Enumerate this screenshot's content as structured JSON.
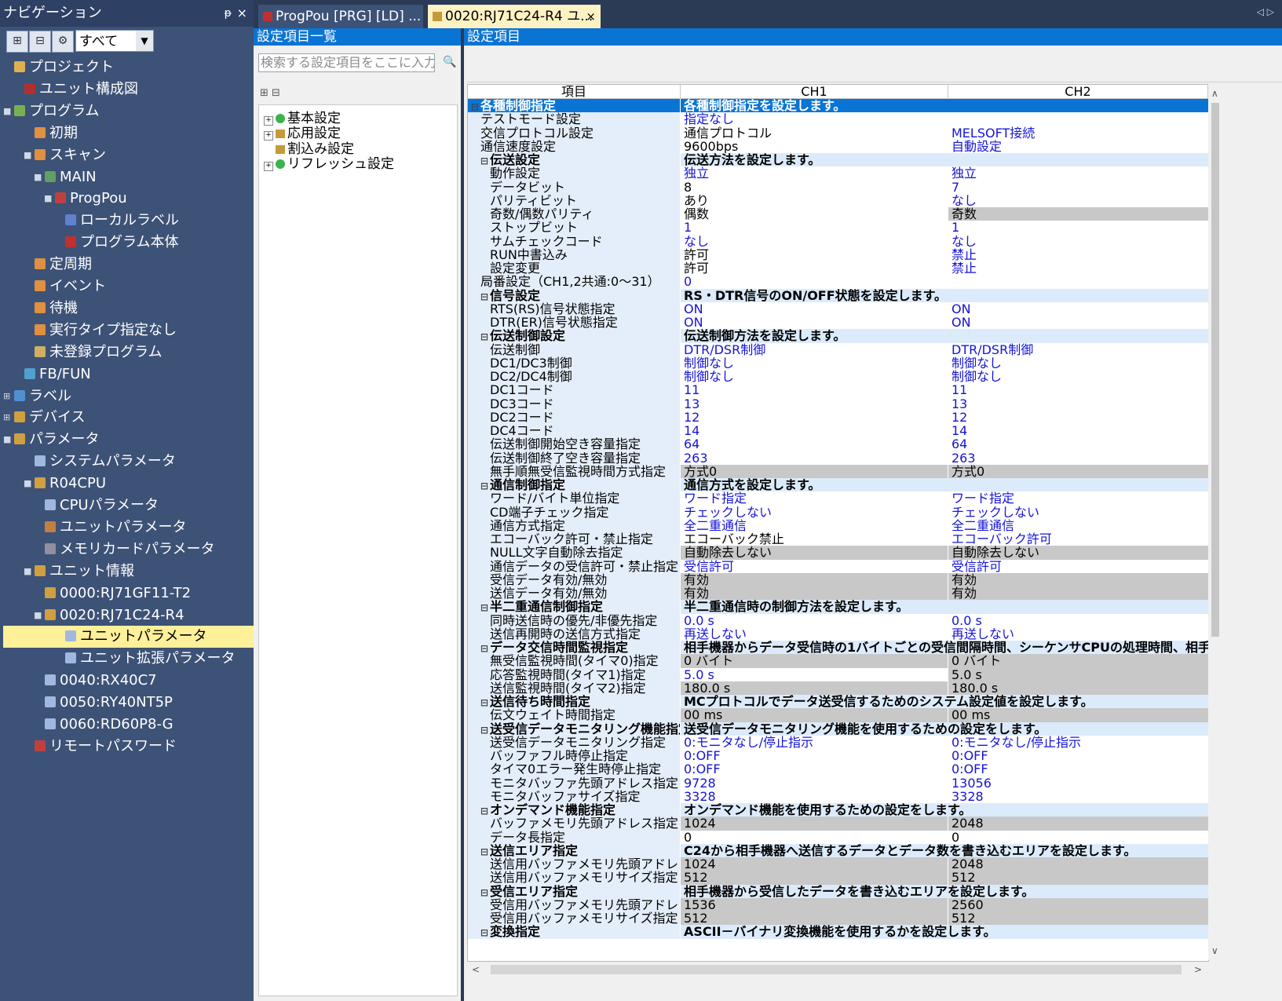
{
  "nav": {
    "title": "ナビゲーション",
    "pin": "ᵽ",
    "close": "×",
    "filter": "すべて",
    "items": [
      {
        "label": "プロジェクト",
        "indent": 0,
        "icon": "project-icon",
        "color": "#e0b050",
        "exp": ""
      },
      {
        "label": "ユニット構成図",
        "indent": 1,
        "icon": "unit-config-icon",
        "color": "#b03030",
        "exp": ""
      },
      {
        "label": "プログラム",
        "indent": 0,
        "icon": "program-folder-icon",
        "color": "#78b050",
        "exp": "■"
      },
      {
        "label": "初期",
        "indent": 2,
        "icon": "program-type-icon",
        "color": "#e09040",
        "exp": ""
      },
      {
        "label": "スキャン",
        "indent": 2,
        "icon": "program-type-icon",
        "color": "#e09040",
        "exp": "■"
      },
      {
        "label": "MAIN",
        "indent": 3,
        "icon": "task-icon",
        "color": "#60a060",
        "exp": "■"
      },
      {
        "label": "ProgPou",
        "indent": 4,
        "icon": "pou-icon",
        "color": "#c04040",
        "exp": "■"
      },
      {
        "label": "ローカルラベル",
        "indent": 5,
        "icon": "local-label-icon",
        "color": "#6080d0",
        "exp": ""
      },
      {
        "label": "プログラム本体",
        "indent": 5,
        "icon": "program-body-icon",
        "color": "#c03030",
        "exp": ""
      },
      {
        "label": "定周期",
        "indent": 2,
        "icon": "program-type-icon",
        "color": "#e09040",
        "exp": ""
      },
      {
        "label": "イベント",
        "indent": 2,
        "icon": "program-type-icon",
        "color": "#e09040",
        "exp": ""
      },
      {
        "label": "待機",
        "indent": 2,
        "icon": "program-type-icon",
        "color": "#e09040",
        "exp": ""
      },
      {
        "label": "実行タイプ指定なし",
        "indent": 2,
        "icon": "program-type-icon",
        "color": "#e09040",
        "exp": ""
      },
      {
        "label": "未登録プログラム",
        "indent": 2,
        "icon": "unregistered-icon",
        "color": "#d0b060",
        "exp": ""
      },
      {
        "label": "FB/FUN",
        "indent": 1,
        "icon": "fb-icon",
        "color": "#50a0d0",
        "exp": ""
      },
      {
        "label": "ラベル",
        "indent": 0,
        "icon": "label-icon",
        "color": "#5090d0",
        "exp": "⊞"
      },
      {
        "label": "デバイス",
        "indent": 0,
        "icon": "device-icon",
        "color": "#d0a040",
        "exp": "⊞"
      },
      {
        "label": "パラメータ",
        "indent": 0,
        "icon": "parameter-icon",
        "color": "#d0a040",
        "exp": "■"
      },
      {
        "label": "システムパラメータ",
        "indent": 2,
        "icon": "system-param-icon",
        "color": "#a0b8e0",
        "exp": ""
      },
      {
        "label": "R04CPU",
        "indent": 2,
        "icon": "cpu-icon",
        "color": "#d0a040",
        "exp": "■"
      },
      {
        "label": "CPUパラメータ",
        "indent": 3,
        "icon": "cpu-param-icon",
        "color": "#a0b8e0",
        "exp": ""
      },
      {
        "label": "ユニットパラメータ",
        "indent": 3,
        "icon": "unit-param-icon",
        "color": "#c08040",
        "exp": ""
      },
      {
        "label": "メモリカードパラメータ",
        "indent": 3,
        "icon": "memory-card-icon",
        "color": "#9090a0",
        "exp": ""
      },
      {
        "label": "ユニット情報",
        "indent": 2,
        "icon": "unit-info-icon",
        "color": "#d0a040",
        "exp": "■"
      },
      {
        "label": "0000:RJ71GF11-T2",
        "indent": 3,
        "icon": "module-icon",
        "color": "#d0a040",
        "exp": ""
      },
      {
        "label": "0020:RJ71C24-R4",
        "indent": 3,
        "icon": "module-icon",
        "color": "#d0a040",
        "exp": "■"
      },
      {
        "label": "ユニットパラメータ",
        "indent": 5,
        "icon": "module-param-icon",
        "color": "#a0b8e0",
        "exp": "",
        "selected": true
      },
      {
        "label": "ユニット拡張パラメータ",
        "indent": 5,
        "icon": "module-ext-param-icon",
        "color": "#a0b8e0",
        "exp": ""
      },
      {
        "label": "0040:RX40C7",
        "indent": 3,
        "icon": "module-icon",
        "color": "#a0b8e0",
        "exp": ""
      },
      {
        "label": "0050:RY40NT5P",
        "indent": 3,
        "icon": "module-icon",
        "color": "#a0b8e0",
        "exp": ""
      },
      {
        "label": "0060:RD60P8-G",
        "indent": 3,
        "icon": "module-icon",
        "color": "#a0b8e0",
        "exp": ""
      },
      {
        "label": "リモートパスワード",
        "indent": 2,
        "icon": "remote-password-icon",
        "color": "#c04040",
        "exp": ""
      }
    ]
  },
  "tabs": [
    {
      "label": "ProgPou [PRG] [LD] ...",
      "icon": "pou-icon"
    },
    {
      "label": "0020:RJ71C24-R4 ユ...",
      "icon": "module-icon",
      "close": "×"
    }
  ],
  "tab_scroll": "◁ ▷",
  "list_pane": {
    "title": "設定項目一覧",
    "search_placeholder": "検索する設定項目をここに入力",
    "tools": "⊞  ⊟",
    "items": [
      {
        "label": "基本設定",
        "icon": "check"
      },
      {
        "label": "応用設定",
        "icon": "folder"
      },
      {
        "label": "割込み設定",
        "icon": "folder",
        "noexp": true
      },
      {
        "label": "リフレッシュ設定",
        "icon": "check"
      }
    ]
  },
  "grid_pane": {
    "title": "設定項目",
    "headers": {
      "item": "項目",
      "ch1": "CH1",
      "ch2": "CH2"
    },
    "rows": [
      {
        "g": 1,
        "sel": 1,
        "lvl": 0,
        "name": "各種制御指定",
        "desc": "各種制御指定を設定します。"
      },
      {
        "lvl": 1,
        "name": "テストモード設定",
        "v1": "指定なし",
        "b1": 1,
        "v2": ""
      },
      {
        "lvl": 1,
        "name": "交信プロトコル設定",
        "v1": "通信プロトコル",
        "v2": "MELSOFT接続",
        "b2": 1
      },
      {
        "lvl": 1,
        "name": "通信速度設定",
        "v1": "9600bps",
        "v2": "自動設定",
        "b2": 1
      },
      {
        "g": 1,
        "lvl": 1,
        "name": "伝送設定",
        "desc": "伝送方法を設定します。"
      },
      {
        "lvl": 2,
        "name": "動作設定",
        "v1": "独立",
        "b1": 1,
        "v2": "独立",
        "b2": 1
      },
      {
        "lvl": 2,
        "name": "データビット",
        "v1": "8",
        "v2": "7",
        "b2": 1
      },
      {
        "lvl": 2,
        "name": "パリティビット",
        "v1": "あり",
        "v2": "なし",
        "b2": 1
      },
      {
        "lvl": 2,
        "name": "奇数/偶数パリティ",
        "v1": "偶数",
        "v2": "奇数",
        "g2": 1
      },
      {
        "lvl": 2,
        "name": "ストップビット",
        "v1": "1",
        "b1": 1,
        "v2": "1",
        "b2": 1
      },
      {
        "lvl": 2,
        "name": "サムチェックコード",
        "v1": "なし",
        "b1": 1,
        "v2": "なし",
        "b2": 1
      },
      {
        "lvl": 2,
        "name": "RUN中書込み",
        "v1": "許可",
        "v2": "禁止",
        "b2": 1
      },
      {
        "lvl": 2,
        "name": "設定変更",
        "v1": "許可",
        "v2": "禁止",
        "b2": 1
      },
      {
        "lvl": 1,
        "name": "局番設定（CH1,2共通:0～31）",
        "v1": "0",
        "b1": 1,
        "v2": ""
      },
      {
        "g": 1,
        "lvl": 1,
        "name": "信号設定",
        "desc": "RS・DTR信号のON/OFF状態を設定します。"
      },
      {
        "lvl": 2,
        "name": "RTS(RS)信号状態指定",
        "v1": "ON",
        "b1": 1,
        "v2": "ON",
        "b2": 1
      },
      {
        "lvl": 2,
        "name": "DTR(ER)信号状態指定",
        "v1": "ON",
        "b1": 1,
        "v2": "ON",
        "b2": 1
      },
      {
        "g": 1,
        "lvl": 1,
        "name": "伝送制御設定",
        "desc": "伝送制御方法を設定します。"
      },
      {
        "lvl": 2,
        "name": "伝送制御",
        "v1": "DTR/DSR制御",
        "b1": 1,
        "v2": "DTR/DSR制御",
        "b2": 1
      },
      {
        "lvl": 2,
        "name": "DC1/DC3制御",
        "v1": "制御なし",
        "b1": 1,
        "v2": "制御なし",
        "b2": 1
      },
      {
        "lvl": 2,
        "name": "DC2/DC4制御",
        "v1": "制御なし",
        "b1": 1,
        "v2": "制御なし",
        "b2": 1
      },
      {
        "lvl": 2,
        "name": "DC1コード",
        "v1": "11",
        "b1": 1,
        "v2": "11",
        "b2": 1
      },
      {
        "lvl": 2,
        "name": "DC3コード",
        "v1": "13",
        "b1": 1,
        "v2": "13",
        "b2": 1
      },
      {
        "lvl": 2,
        "name": "DC2コード",
        "v1": "12",
        "b1": 1,
        "v2": "12",
        "b2": 1
      },
      {
        "lvl": 2,
        "name": "DC4コード",
        "v1": "14",
        "b1": 1,
        "v2": "14",
        "b2": 1
      },
      {
        "lvl": 2,
        "name": "伝送制御開始空き容量指定",
        "v1": "64",
        "b1": 1,
        "v2": "64",
        "b2": 1
      },
      {
        "lvl": 2,
        "name": "伝送制御終了空き容量指定",
        "v1": "263",
        "b1": 1,
        "v2": "263",
        "b2": 1
      },
      {
        "lvl": 2,
        "name": "無手順無受信監視時間方式指定",
        "v1": "方式0",
        "g1": 1,
        "v2": "方式0",
        "g2": 1
      },
      {
        "g": 1,
        "lvl": 1,
        "name": "通信制御指定",
        "desc": "通信方式を設定します。"
      },
      {
        "lvl": 2,
        "name": "ワード/バイト単位指定",
        "v1": "ワード指定",
        "b1": 1,
        "v2": "ワード指定",
        "b2": 1
      },
      {
        "lvl": 2,
        "name": "CD端子チェック指定",
        "v1": "チェックしない",
        "b1": 1,
        "v2": "チェックしない",
        "b2": 1
      },
      {
        "lvl": 2,
        "name": "通信方式指定",
        "v1": "全二重通信",
        "b1": 1,
        "v2": "全二重通信",
        "b2": 1
      },
      {
        "lvl": 2,
        "name": "エコーバック許可・禁止指定",
        "v1": "エコーバック禁止",
        "v2": "エコーバック許可",
        "b2": 1
      },
      {
        "lvl": 2,
        "name": "NULL文字自動除去指定",
        "v1": "自動除去しない",
        "g1": 1,
        "v2": "自動除去しない",
        "g2": 1
      },
      {
        "lvl": 2,
        "name": "通信データの受信許可・禁止指定",
        "v1": "受信許可",
        "b1": 1,
        "v2": "受信許可",
        "b2": 1
      },
      {
        "lvl": 2,
        "name": "受信データ有効/無効",
        "v1": "有効",
        "g1": 1,
        "v2": "有効",
        "g2": 1
      },
      {
        "lvl": 2,
        "name": "送信データ有効/無効",
        "v1": "有効",
        "g1": 1,
        "v2": "有効",
        "g2": 1
      },
      {
        "g": 1,
        "lvl": 1,
        "name": "半二重通信制御指定",
        "desc": "半二重通信時の制御方法を設定します。"
      },
      {
        "lvl": 2,
        "name": "同時送信時の優先/非優先指定",
        "v1": "0.0 s",
        "b1": 1,
        "v2": "0.0 s",
        "b2": 1
      },
      {
        "lvl": 2,
        "name": "送信再開時の送信方式指定",
        "v1": "再送しない",
        "b1": 1,
        "v2": "再送しない",
        "b2": 1
      },
      {
        "g": 1,
        "lvl": 1,
        "name": "データ交信時間監視指定",
        "desc": "相手機器からデータ受信時の1バイトごとの受信間隔時間、シーケンサCPUの処理時間、相手機"
      },
      {
        "lvl": 2,
        "name": "無受信監視時間(タイマ0)指定",
        "v1": "0 バイト",
        "g1": 1,
        "v2": "0 バイト",
        "g2": 1
      },
      {
        "lvl": 2,
        "name": "応答監視時間(タイマ1)指定",
        "v1": "5.0 s",
        "b1": 1,
        "v2": "5.0 s",
        "g2": 1
      },
      {
        "lvl": 2,
        "name": "送信監視時間(タイマ2)指定",
        "v1": "180.0 s",
        "g1": 1,
        "v2": "180.0 s",
        "g2": 1
      },
      {
        "g": 1,
        "lvl": 1,
        "name": "送信待ち時間指定",
        "desc": "MCプロトコルでデータ送受信するためのシステム設定値を設定します。"
      },
      {
        "lvl": 2,
        "name": "伝文ウェイト時間指定",
        "v1": "00 ms",
        "g1": 1,
        "v2": "00 ms",
        "g2": 1
      },
      {
        "g": 1,
        "lvl": 1,
        "name": "送受信データモニタリング機能指定",
        "desc": "送受信データモニタリング機能を使用するための設定をします。"
      },
      {
        "lvl": 2,
        "name": "送受信データモニタリング指定",
        "v1": "0:モニタなし/停止指示",
        "b1": 1,
        "v2": "0:モニタなし/停止指示",
        "b2": 1
      },
      {
        "lvl": 2,
        "name": "バッファフル時停止指定",
        "v1": "0:OFF",
        "b1": 1,
        "v2": "0:OFF",
        "b2": 1
      },
      {
        "lvl": 2,
        "name": "タイマ0エラー発生時停止指定",
        "v1": "0:OFF",
        "b1": 1,
        "v2": "0:OFF",
        "b2": 1
      },
      {
        "lvl": 2,
        "name": "モニタバッファ先頭アドレス指定",
        "v1": "9728",
        "b1": 1,
        "v2": "13056",
        "b2": 1
      },
      {
        "lvl": 2,
        "name": "モニタバッファサイズ指定",
        "v1": "3328",
        "b1": 1,
        "v2": "3328",
        "b2": 1
      },
      {
        "g": 1,
        "lvl": 1,
        "name": "オンデマンド機能指定",
        "desc": "オンデマンド機能を使用するための設定をします。"
      },
      {
        "lvl": 2,
        "name": "バッファメモリ先頭アドレス指定",
        "v1": "1024",
        "g1": 1,
        "v2": "2048",
        "g2": 1
      },
      {
        "lvl": 2,
        "name": "データ長指定",
        "v1": "0",
        "v2": "0"
      },
      {
        "g": 1,
        "lvl": 1,
        "name": "送信エリア指定",
        "desc": "C24から相手機器へ送信するデータとデータ数を書き込むエリアを設定します。"
      },
      {
        "lvl": 2,
        "name": "送信用バッファメモリ先頭アドレス指定",
        "v1": "1024",
        "g1": 1,
        "v2": "2048",
        "g2": 1
      },
      {
        "lvl": 2,
        "name": "送信用バッファメモリサイズ指定",
        "v1": "512",
        "g1": 1,
        "v2": "512",
        "g2": 1
      },
      {
        "g": 1,
        "lvl": 1,
        "name": "受信エリア指定",
        "desc": "相手機器から受信したデータを書き込むエリアを設定します。"
      },
      {
        "lvl": 2,
        "name": "受信用バッファメモリ先頭アドレス指定",
        "v1": "1536",
        "g1": 1,
        "v2": "2560",
        "g2": 1
      },
      {
        "lvl": 2,
        "name": "受信用バッファメモリサイズ指定",
        "v1": "512",
        "g1": 1,
        "v2": "512",
        "g2": 1
      },
      {
        "g": 1,
        "lvl": 1,
        "name": "変換指定",
        "desc": "ASCII－バイナリ変換機能を使用するかを設定します。"
      }
    ]
  }
}
